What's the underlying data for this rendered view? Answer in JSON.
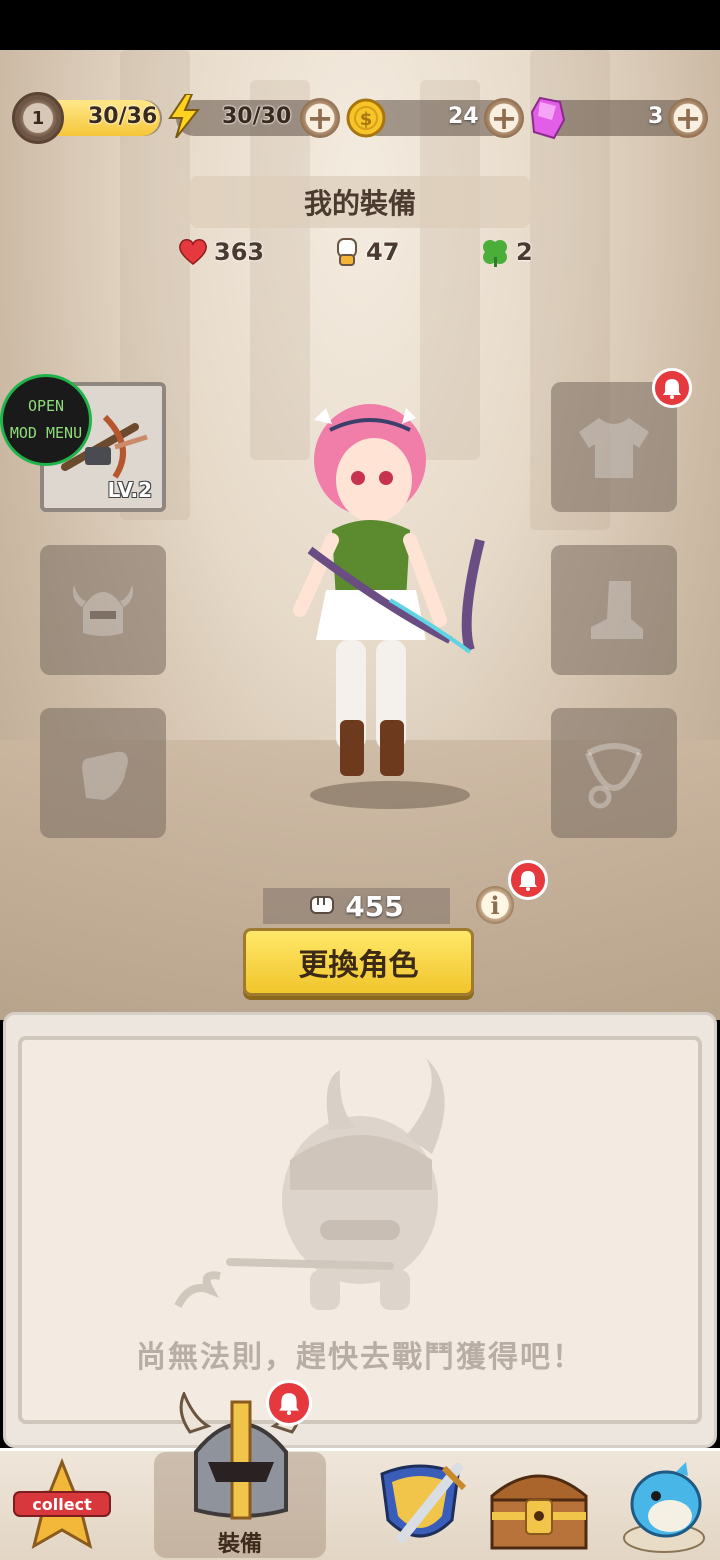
{
  "top_bar": {
    "level": "1",
    "xp": "30/36",
    "energy": "30/30",
    "coins": "24",
    "gems": "3",
    "energy_icon": "lightning-icon",
    "coin_icon": "coin-icon",
    "gem_icon": "gem-icon"
  },
  "header": {
    "title": "我的裝備"
  },
  "stats": {
    "hp": "363",
    "attack": "47",
    "luck": "2"
  },
  "equipment": {
    "weapon_level": "LV.2"
  },
  "mod_menu": {
    "line1": "OPEN",
    "line2": "MOD MENU"
  },
  "power": {
    "value": "455"
  },
  "buttons": {
    "change_character": "更換角色"
  },
  "panel": {
    "empty_message": "尚無法則，趕快去戰鬥獲得吧！"
  },
  "nav": {
    "collect_label": "collect",
    "equipment_label": "裝備"
  },
  "colors": {
    "accent_yellow": "#f1c52c",
    "notification_red": "#e5393e",
    "mod_green": "#1fb34a"
  }
}
